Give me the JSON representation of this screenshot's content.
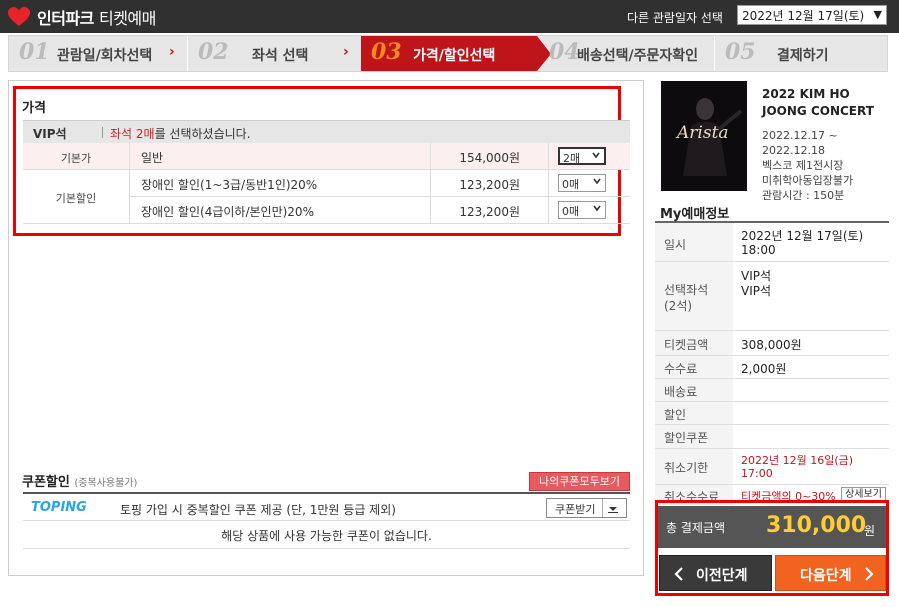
{
  "header": {
    "brand": "인터파크",
    "brand_sub": "티켓예매",
    "date_label": "다른 관람일자 선택",
    "date_selected": "2022년 12월 17일(토)"
  },
  "steps": [
    {
      "num": "01",
      "label": "관람일/회차선택"
    },
    {
      "num": "02",
      "label": "좌석 선택"
    },
    {
      "num": "03",
      "label": "가격/할인선택"
    },
    {
      "num": "04",
      "label": "배송선택/주문자확인"
    },
    {
      "num": "05",
      "label": "결제하기"
    }
  ],
  "price": {
    "title": "가격",
    "grade": "VIP석",
    "msg_highlight": "좌석 2매",
    "msg_rest": "를 선택하셨습니다.",
    "rows": [
      {
        "label": "기본가",
        "name": "일반",
        "amount": "154,000원",
        "qty": "2매"
      },
      {
        "label": "기본할인",
        "name": "장애인 할인(1~3급/동반1인)20%",
        "amount": "123,200원",
        "qty": "0매"
      },
      {
        "label": "",
        "name": "장애인 할인(4급이하/본인만)20%",
        "amount": "123,200원",
        "qty": "0매"
      }
    ]
  },
  "coupon": {
    "title": "쿠폰할인",
    "note": "(중복사용불가)",
    "my_coupon_btn": "나의쿠폰모두보기",
    "brand": "TOPING",
    "desc": "토핑 가입 시 중복할인 쿠폰 제공 (단, 1만원 등급 제외)",
    "get_btn": "쿠폰받기",
    "empty": "해당 상품에 사용 가능한 쿠폰이 없습니다."
  },
  "show": {
    "title": "2022 KIM HO JOONG CONCERT",
    "period_start": "2022.12.17 ~",
    "period_end": "2022.12.18",
    "venue": "벡스코 제1전시장",
    "age": "미취학아동입장불가",
    "runtime": "관람시간 : 150분",
    "poster_text": "Arista"
  },
  "myinfo": {
    "title": "My예매정보",
    "date_k": "일시",
    "date_v1": "2022년 12월 17일(토)",
    "date_v2": "18:00",
    "seat_k1": "선택좌석",
    "seat_k2": "(2석)",
    "seat_v1": "VIP석",
    "seat_v2": "VIP석",
    "ticket_k": "티켓금액",
    "ticket_v": "308,000원",
    "fee_k": "수수료",
    "fee_v": "2,000원",
    "ship_k": "배송료",
    "disc_k": "할인",
    "coupon_k": "할인쿠폰",
    "cancel_k": "취소기한",
    "cancel_v1": "2022년 12월 16일(금)",
    "cancel_v2": "17:00",
    "cancelfee_k": "취소수수료",
    "cancelfee_v": "티켓금액의 0~30%",
    "detail_btn": "상세보기"
  },
  "total": {
    "label": "총 결제금액",
    "amount": "310,000",
    "unit": "원"
  },
  "nav": {
    "prev": "이전단계",
    "next": "다음단계"
  }
}
